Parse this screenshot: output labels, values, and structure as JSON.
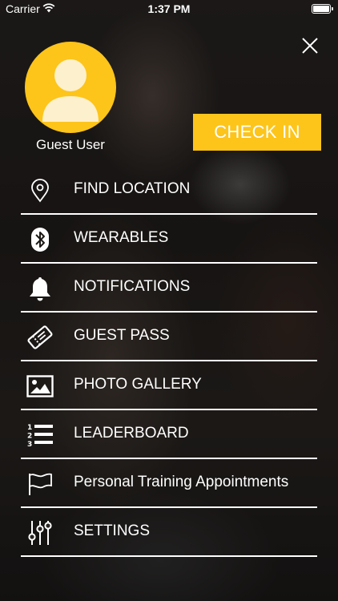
{
  "status_bar": {
    "carrier": "Carrier",
    "time": "1:37 PM"
  },
  "profile": {
    "name": "Guest User"
  },
  "check_in": {
    "label": "CHECK IN"
  },
  "colors": {
    "accent": "#fdc41a",
    "text": "#ffffff"
  },
  "menu": [
    {
      "label": "FIND LOCATION",
      "icon": "location-pin-icon"
    },
    {
      "label": "WEARABLES",
      "icon": "bluetooth-icon"
    },
    {
      "label": "NOTIFICATIONS",
      "icon": "bell-icon"
    },
    {
      "label": "GUEST PASS",
      "icon": "ticket-icon"
    },
    {
      "label": "PHOTO GALLERY",
      "icon": "photo-icon"
    },
    {
      "label": "LEADERBOARD",
      "icon": "numbered-list-icon"
    },
    {
      "label": "Personal Training Appointments",
      "icon": "flag-icon"
    },
    {
      "label": "SETTINGS",
      "icon": "sliders-icon"
    }
  ]
}
